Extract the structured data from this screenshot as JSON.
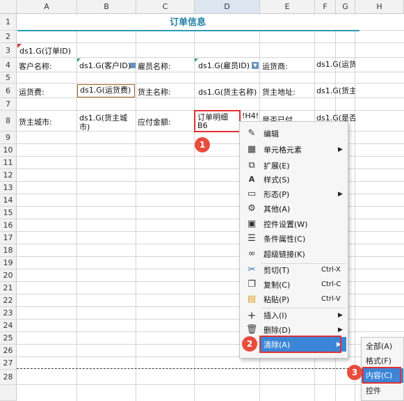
{
  "columns": [
    "A",
    "B",
    "C",
    "D",
    "E",
    "F",
    "G",
    "H"
  ],
  "rows": [
    "1",
    "2",
    "3",
    "4",
    "5",
    "6",
    "7",
    "8",
    "9",
    "10",
    "11",
    "12",
    "13",
    "14",
    "15",
    "16",
    "17",
    "18",
    "19",
    "20",
    "21",
    "22",
    "23",
    "24",
    "25",
    "26",
    "27",
    "28"
  ],
  "title": "订单信息",
  "cells": {
    "order_id": "ds1.G(订单ID)",
    "customer_label": "客户名称:",
    "customer_value": "ds1.G(客户ID)",
    "employee_label": "雇员名称:",
    "employee_value": "ds1.G(雇员ID)",
    "shipper_label": "运货商:",
    "shipper_value": "ds1.G(运货",
    "freight_label": "运货费:",
    "freight_value": "ds1.G(运货费)",
    "cargo_name_label": "货主名称:",
    "cargo_name_value": "ds1.G(货主名称)",
    "cargo_addr_label": "货主地址:",
    "cargo_addr_value": "ds1.G(货主",
    "cargo_city_label": "货主城市:",
    "cargo_city_value_1": "ds1.G(货主城",
    "cargo_city_value_2": "市)",
    "amount_label": "应付金额:",
    "detail_value_1": "订单明细",
    "detail_value_2": "B6",
    "d8_extra": "!H4!",
    "e8_partial": "是否已付",
    "f8_value": "ds1.G(是否"
  },
  "context_menu": {
    "items": [
      {
        "label": "编辑",
        "shortcut": "",
        "icon": "pencil-icon",
        "submenu": false
      },
      {
        "label": "单元格元素",
        "shortcut": "",
        "icon": "cell-element-icon",
        "submenu": true
      },
      {
        "label": "扩展(E)",
        "shortcut": "",
        "icon": "expand-icon",
        "submenu": false
      },
      {
        "label": "样式(S)",
        "shortcut": "",
        "icon": "style-icon",
        "submenu": false
      },
      {
        "label": "形态(P)",
        "shortcut": "",
        "icon": "form-icon",
        "submenu": true
      },
      {
        "label": "其他(A)",
        "shortcut": "",
        "icon": "gear-icon",
        "submenu": false
      },
      {
        "label": "控件设置(W)",
        "shortcut": "",
        "icon": "widget-icon",
        "submenu": false
      },
      {
        "label": "条件属性(C)",
        "shortcut": "",
        "icon": "condition-icon",
        "submenu": false
      },
      {
        "label": "超级链接(K)",
        "shortcut": "",
        "icon": "link-icon",
        "submenu": false
      },
      {
        "label": "剪切(T)",
        "shortcut": "Ctrl-X",
        "icon": "scissors-icon",
        "submenu": false
      },
      {
        "label": "复制(C)",
        "shortcut": "Ctrl-C",
        "icon": "copy-icon",
        "submenu": false
      },
      {
        "label": "粘贴(P)",
        "shortcut": "Ctrl-V",
        "icon": "paste-icon",
        "submenu": false
      },
      {
        "label": "插入(I)",
        "shortcut": "",
        "icon": "plus-icon",
        "submenu": true
      },
      {
        "label": "删除(D)",
        "shortcut": "",
        "icon": "trash-icon",
        "submenu": true
      },
      {
        "label": "清除(A)",
        "shortcut": "",
        "icon": "clear-icon",
        "submenu": true
      }
    ]
  },
  "clear_submenu": {
    "items": [
      "全部(A)",
      "格式(F)",
      "内容(C)",
      "控件"
    ]
  },
  "badges": [
    "1",
    "2",
    "3"
  ],
  "colors": {
    "title": "#1f7ea8",
    "highlight": "#3c86d8",
    "annotation": "#e84c3d"
  }
}
